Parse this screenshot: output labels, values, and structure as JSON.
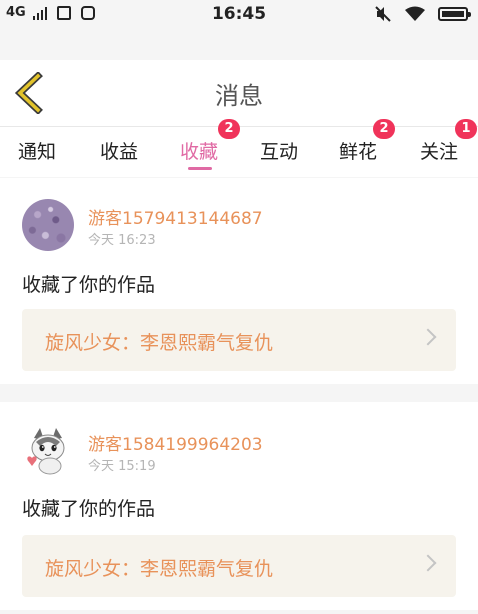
{
  "status_bar": {
    "network": "4G",
    "time": "16:45"
  },
  "header": {
    "title": "消息"
  },
  "tabs": [
    {
      "label": "通知",
      "badge": null,
      "active": false
    },
    {
      "label": "收益",
      "badge": null,
      "active": false
    },
    {
      "label": "收藏",
      "badge": "2",
      "active": true
    },
    {
      "label": "互动",
      "badge": null,
      "active": false
    },
    {
      "label": "鲜花",
      "badge": "2",
      "active": false
    },
    {
      "label": "关注",
      "badge": "1",
      "active": false
    }
  ],
  "messages": [
    {
      "username": "游客1579413144687",
      "time": "今天 16:23",
      "action": "收藏了你的作品",
      "work_title": "旋风少女：李恩熙霸气复仇"
    },
    {
      "username": "游客1584199964203",
      "time": "今天 15:19",
      "action": "收藏了你的作品",
      "work_title": "旋风少女：李恩熙霸气复仇"
    }
  ],
  "colors": {
    "accent_pink": "#e06aa4",
    "badge_red": "#f0335a",
    "username_orange": "#e8925a",
    "back_arrow_yellow": "#e2c32b",
    "work_box_bg": "#f6f3ec"
  }
}
